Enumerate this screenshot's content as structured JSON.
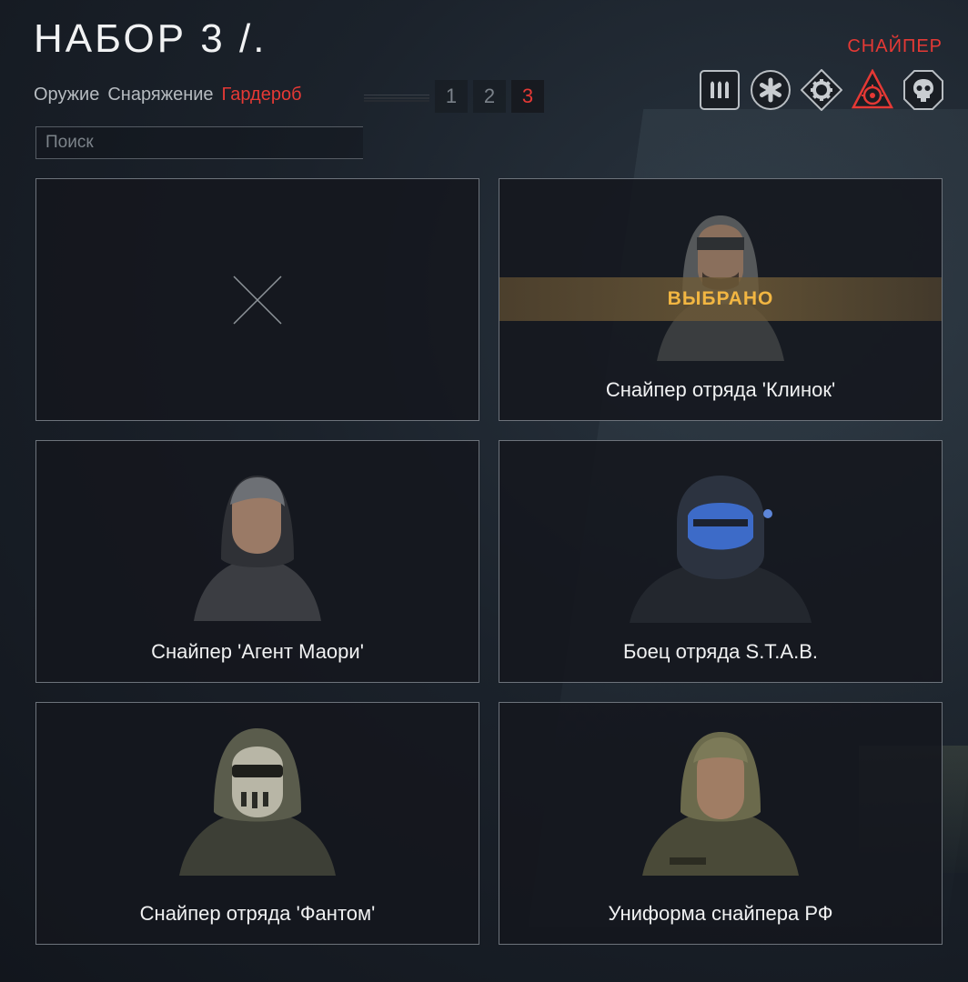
{
  "header": {
    "title": "НАБОР 3 /.",
    "class_name": "СНАЙПЕР"
  },
  "tabs": [
    {
      "label": "Оружие",
      "active": false
    },
    {
      "label": "Снаряжение",
      "active": false
    },
    {
      "label": "Гардероб",
      "active": true
    }
  ],
  "pager": {
    "pages": [
      "1",
      "2",
      "3"
    ],
    "active": "3"
  },
  "class_icons": [
    {
      "icon": "ammo-icon",
      "active": false
    },
    {
      "icon": "medic-icon",
      "active": false
    },
    {
      "icon": "engineer-gear-icon",
      "active": false
    },
    {
      "icon": "sniper-crosshair-icon",
      "active": true
    },
    {
      "icon": "skull-icon",
      "active": false
    }
  ],
  "search": {
    "placeholder": "Поиск",
    "value": ""
  },
  "cards": [
    {
      "label": "",
      "empty": true,
      "selected": false
    },
    {
      "label": "Снайпер отряда 'Клинок'",
      "selected": true,
      "badge": "ВЫБРАНО"
    },
    {
      "label": "Снайпер 'Агент Маори'",
      "selected": false
    },
    {
      "label": "Боец отряда S.T.A.B.",
      "selected": false
    },
    {
      "label": "Снайпер отряда 'Фантом'",
      "selected": false
    },
    {
      "label": "Униформа снайпера РФ",
      "selected": false
    }
  ],
  "colors": {
    "accent": "#e53935",
    "selected_badge": "#f2b642"
  }
}
